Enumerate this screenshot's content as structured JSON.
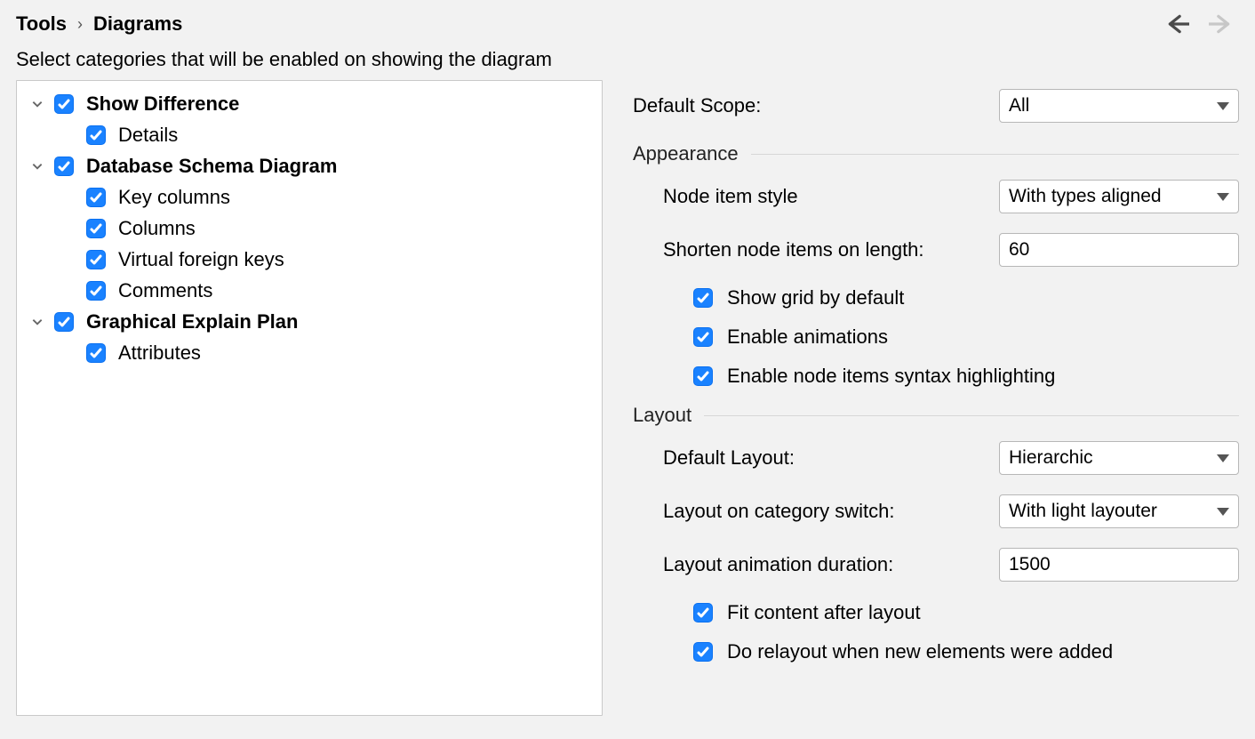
{
  "breadcrumb": {
    "item0": "Tools",
    "item1": "Diagrams"
  },
  "subtitle": "Select categories that will be enabled on showing the diagram",
  "tree": {
    "showDifference": {
      "label": "Show Difference"
    },
    "details": {
      "label": "Details"
    },
    "databaseSchemaDiagram": {
      "label": "Database Schema Diagram"
    },
    "keyColumns": {
      "label": "Key columns"
    },
    "columns": {
      "label": "Columns"
    },
    "virtualForeignKeys": {
      "label": "Virtual foreign keys"
    },
    "comments": {
      "label": "Comments"
    },
    "graphicalExplainPlan": {
      "label": "Graphical Explain Plan"
    },
    "attributes": {
      "label": "Attributes"
    }
  },
  "form": {
    "defaultScope": {
      "label": "Default Scope:",
      "value": "All"
    },
    "appearanceTitle": "Appearance",
    "nodeItemStyle": {
      "label": "Node item style",
      "value": "With types aligned"
    },
    "shortenLength": {
      "label": "Shorten node items on length:",
      "value": "60"
    },
    "showGrid": {
      "label": "Show grid by default"
    },
    "enableAnimations": {
      "label": "Enable animations"
    },
    "syntaxHighlight": {
      "label": "Enable node items syntax highlighting"
    },
    "layoutTitle": "Layout",
    "defaultLayout": {
      "label": "Default Layout:",
      "value": "Hierarchic"
    },
    "layoutOnSwitch": {
      "label": "Layout on category switch:",
      "value": "With light layouter"
    },
    "animationDuration": {
      "label": "Layout animation duration:",
      "value": "1500"
    },
    "fitContent": {
      "label": "Fit content after layout"
    },
    "doRelayout": {
      "label": "Do relayout when new elements were added"
    }
  }
}
